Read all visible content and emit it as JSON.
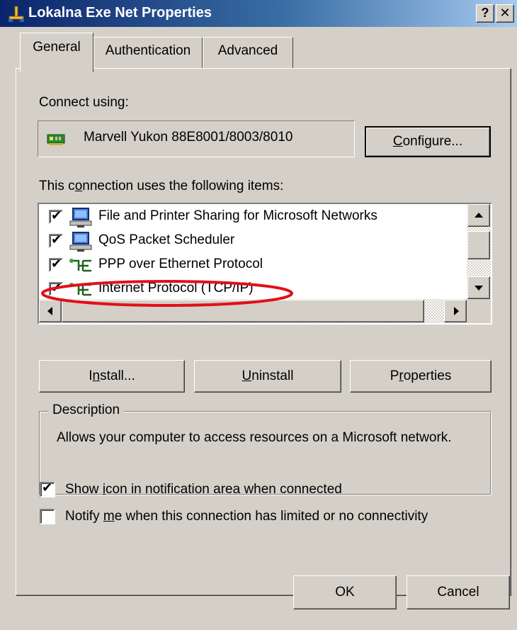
{
  "window": {
    "title": "Lokalna Exe Net Properties",
    "help_label": "?",
    "close_label": "✕"
  },
  "tabs": [
    {
      "label": "General",
      "active": true
    },
    {
      "label": "Authentication",
      "active": false
    },
    {
      "label": "Advanced",
      "active": false
    }
  ],
  "connect_using": {
    "label_pre": "Connect using:",
    "adapter": "Marvell Yukon 88E8001/8003/8010",
    "configure_pre": "",
    "configure_key": "C",
    "configure_post": "onfigure..."
  },
  "items_section": {
    "label_pre": "This c",
    "label_key": "o",
    "label_post": "nnection uses the following items:"
  },
  "items": [
    {
      "label": "File and Printer Sharing for Microsoft Networks",
      "checked": true,
      "icon": "network-computer-icon"
    },
    {
      "label": "QoS Packet Scheduler",
      "checked": true,
      "icon": "network-computer-icon"
    },
    {
      "label": "PPP over Ethernet Protocol",
      "checked": true,
      "icon": "protocol-icon"
    },
    {
      "label": "Internet Protocol (TCP/IP)",
      "checked": true,
      "icon": "protocol-icon"
    }
  ],
  "buttons": {
    "install_pre": "I",
    "install_key": "n",
    "install_post": "stall...",
    "uninstall_pre": "",
    "uninstall_key": "U",
    "uninstall_post": "ninstall",
    "properties_pre": "P",
    "properties_key": "r",
    "properties_post": "operties",
    "ok": "OK",
    "cancel": "Cancel"
  },
  "description": {
    "title": "Description",
    "text": "Allows your computer to access resources on a Microsoft network."
  },
  "options": [
    {
      "pre": "Show ",
      "key": "i",
      "post": "con in notification area when connected",
      "checked": true
    },
    {
      "pre": "Notify ",
      "key": "m",
      "post": "e when this connection has limited or no connectivity",
      "checked": false
    }
  ],
  "colors": {
    "dialog_face": "#d4d0c8",
    "titlebar_start": "#0a246a",
    "titlebar_end": "#a6caf0",
    "annotation": "#e0101a"
  }
}
